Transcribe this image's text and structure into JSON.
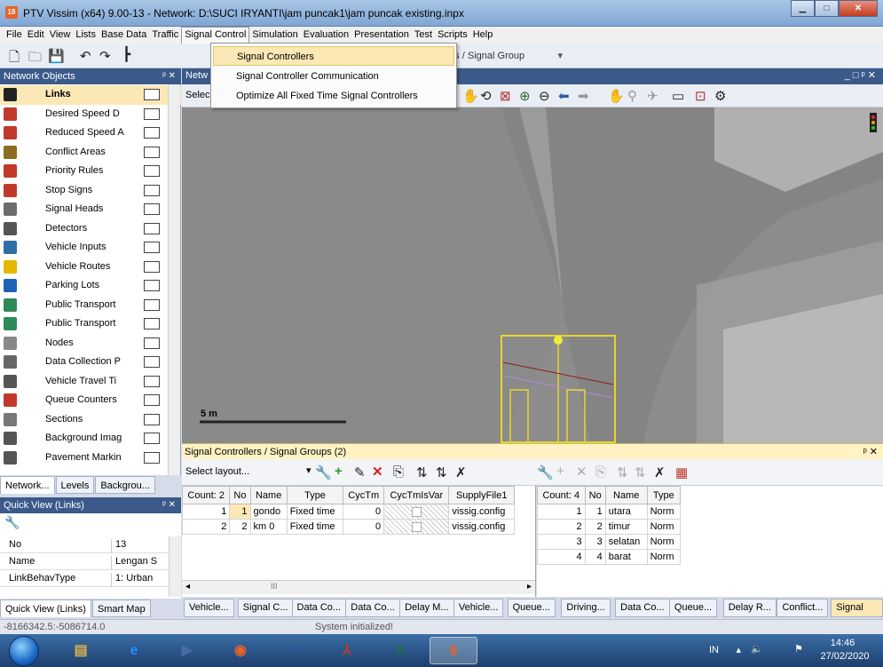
{
  "window": {
    "title": "PTV Vissim (x64) 9.00-13 - Network: D:\\SUCI IRYANTI\\jam puncak1\\jam puncak existing.inpx",
    "icon_text": "18"
  },
  "menubar": [
    "File",
    "Edit",
    "View",
    "Lists",
    "Base Data",
    "Traffic",
    "Signal Control",
    "Simulation",
    "Evaluation",
    "Presentation",
    "Test",
    "Scripts",
    "Help"
  ],
  "open_menu": "Signal Control",
  "dropdown": [
    "Signal Controllers",
    "Signal Controller Communication",
    "Optimize All Fixed Time Signal Controllers"
  ],
  "toolbar": {
    "layout_combo": "lers / Signal Group"
  },
  "network_objects": {
    "title": "Network Objects",
    "items": [
      {
        "label": "Links",
        "icon": "links-icon",
        "color": "#222222"
      },
      {
        "label": "Desired Speed D",
        "icon": "speed-50-icon",
        "color": "#c0392b"
      },
      {
        "label": "Reduced Speed A",
        "icon": "reduced-speed-icon",
        "color": "#c0392b"
      },
      {
        "label": "Conflict Areas",
        "icon": "conflict-area-icon",
        "color": "#8a6d1f"
      },
      {
        "label": "Priority Rules",
        "icon": "priority-rule-icon",
        "color": "#c0392b"
      },
      {
        "label": "Stop Signs",
        "icon": "stop-sign-icon",
        "color": "#c0392b"
      },
      {
        "label": "Signal Heads",
        "icon": "signal-head-icon",
        "color": "#6b6b6b"
      },
      {
        "label": "Detectors",
        "icon": "detector-icon",
        "color": "#555555"
      },
      {
        "label": "Vehicle Inputs",
        "icon": "vehicle-input-icon",
        "color": "#2e6fa8"
      },
      {
        "label": "Vehicle Routes",
        "icon": "vehicle-route-icon",
        "color": "#e5b800"
      },
      {
        "label": "Parking Lots",
        "icon": "parking-lot-icon",
        "color": "#1e63b6"
      },
      {
        "label": "Public Transport",
        "icon": "pt-stop-icon",
        "color": "#2e8b57"
      },
      {
        "label": "Public Transport",
        "icon": "pt-line-icon",
        "color": "#2e8b57"
      },
      {
        "label": "Nodes",
        "icon": "node-icon",
        "color": "#888888"
      },
      {
        "label": "Data Collection P",
        "icon": "data-collection-icon",
        "color": "#666666"
      },
      {
        "label": "Vehicle Travel Ti",
        "icon": "travel-time-icon",
        "color": "#555555"
      },
      {
        "label": "Queue Counters",
        "icon": "queue-counter-icon",
        "color": "#c0392b"
      },
      {
        "label": "Sections",
        "icon": "section-icon",
        "color": "#777777"
      },
      {
        "label": "Background Imag",
        "icon": "background-image-icon",
        "color": "#555555"
      },
      {
        "label": "Pavement Markin",
        "icon": "pavement-marking-icon",
        "color": "#555555"
      }
    ],
    "tabs": [
      "Network...",
      "Levels",
      "Backgrou..."
    ]
  },
  "quick_view": {
    "title": "Quick View (Links)",
    "rows": [
      {
        "key": "No",
        "value": "13"
      },
      {
        "key": "Name",
        "value": "Lengan S"
      },
      {
        "key": "LinkBehavType",
        "value": "1: Urban"
      }
    ],
    "tabs": [
      "Quick View (Links)",
      "Smart Map"
    ]
  },
  "network_view": {
    "title": "Netw",
    "select_text": "Selec",
    "scale_label": "5 m"
  },
  "signal_grid": {
    "title": "Signal Controllers / Signal Groups (2)",
    "select_layout": "Select layout...",
    "left_headers": [
      "Count: 2",
      "No",
      "Name",
      "Type",
      "CycTm",
      "CycTmIsVar",
      "SupplyFile1"
    ],
    "left_rows": [
      {
        "idx": "1",
        "no": "1",
        "name": "gondo",
        "type": "Fixed time",
        "cyctm": "0",
        "supply": "vissig.config"
      },
      {
        "idx": "2",
        "no": "2",
        "name": "km 0",
        "type": "Fixed time",
        "cyctm": "0",
        "supply": "vissig.config"
      }
    ],
    "right_headers": [
      "Count: 4",
      "No",
      "Name",
      "Type"
    ],
    "right_rows": [
      {
        "idx": "1",
        "no": "1",
        "name": "utara",
        "type": "Norm"
      },
      {
        "idx": "2",
        "no": "2",
        "name": "timur",
        "type": "Norm"
      },
      {
        "idx": "3",
        "no": "3",
        "name": "selatan",
        "type": "Norm"
      },
      {
        "idx": "4",
        "no": "4",
        "name": "barat",
        "type": "Norm"
      }
    ],
    "scroll_mark": "III"
  },
  "bottom_tabs": [
    "Vehicle...",
    "Signal C...",
    "Data Co...",
    "Data Co...",
    "Delay M...",
    "Vehicle...",
    "Queue...",
    "Driving...",
    "Data Co...",
    "Queue...",
    "Delay R...",
    "Conflict...",
    "Signal C..."
  ],
  "status": {
    "coords": "-8166342.5:-5086714.0",
    "message": "System initialized!"
  },
  "taskbar": {
    "apps": [
      {
        "name": "explorer",
        "glyph": "▤"
      },
      {
        "name": "ie",
        "glyph": "e"
      },
      {
        "name": "media",
        "glyph": "▶"
      },
      {
        "name": "firefox",
        "glyph": "◉"
      },
      {
        "name": "word",
        "glyph": "W"
      },
      {
        "name": "acrobat",
        "glyph": "⅄"
      },
      {
        "name": "excel",
        "glyph": "X"
      },
      {
        "name": "vissim",
        "glyph": "9"
      }
    ],
    "lang": "IN",
    "time": "14:46",
    "date": "27/02/2020"
  }
}
